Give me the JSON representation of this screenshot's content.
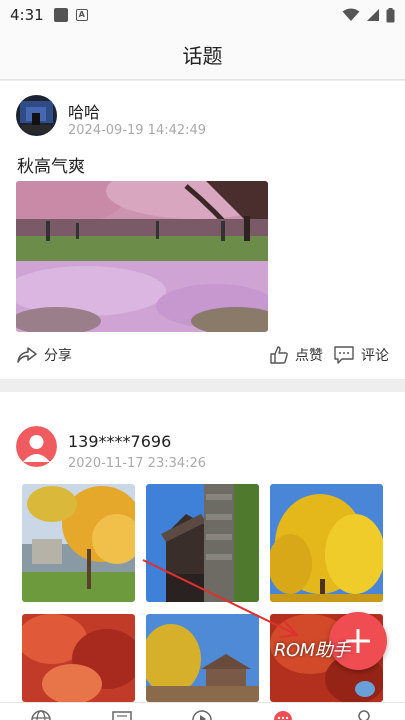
{
  "status_bar": {
    "time": "4:31"
  },
  "header": {
    "title": "话题"
  },
  "posts": [
    {
      "username": "哈哈",
      "datetime": "2024-09-19 14:42:49",
      "text": "秋高气爽",
      "actions": {
        "share": "分享",
        "like": "点赞",
        "comment": "评论"
      }
    },
    {
      "username": "139****7696",
      "datetime": "2020-11-17 23:34:26"
    }
  ],
  "watermark": "ROM助手",
  "colors": {
    "accent": "#ef4d52",
    "fab": "#ef4d52"
  },
  "bottom_nav": {
    "icons": [
      "globe-icon",
      "news-icon",
      "play-icon",
      "chat-icon",
      "profile-icon"
    ]
  }
}
